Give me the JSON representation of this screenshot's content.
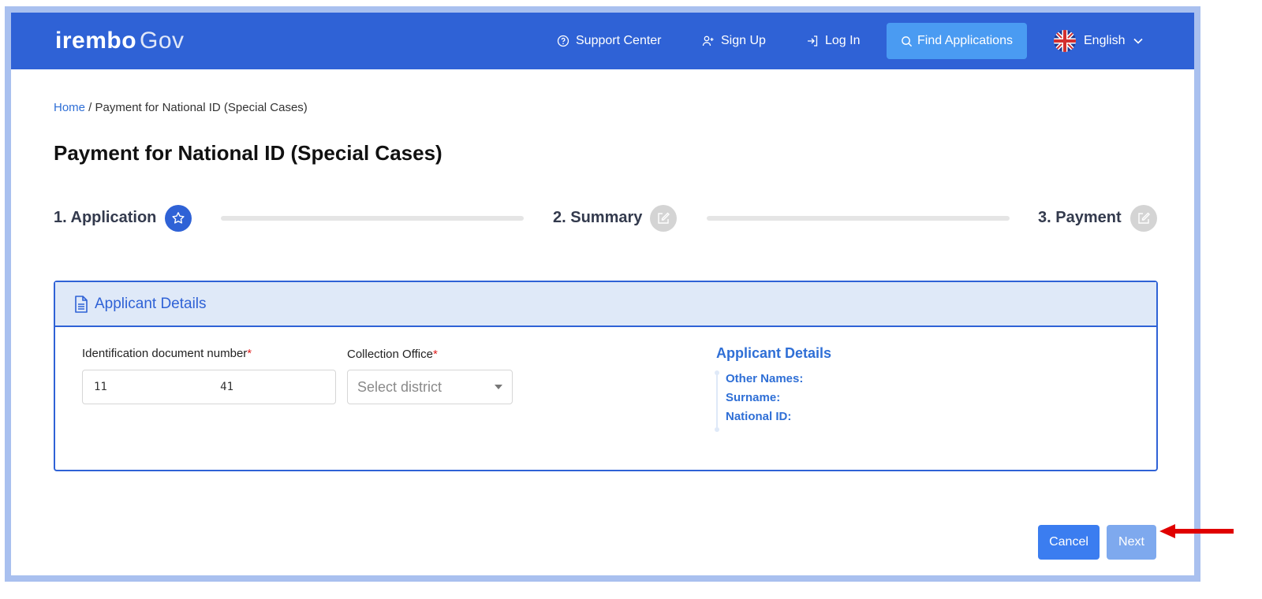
{
  "header": {
    "logo_bold": "irembo",
    "logo_light": "Gov",
    "nav": {
      "support": "Support Center",
      "signup": "Sign Up",
      "login": "Log In",
      "find": "Find Applications"
    },
    "language": "English"
  },
  "breadcrumb": {
    "home": "Home",
    "separator": " / ",
    "current": "Payment for National ID (Special Cases)"
  },
  "page": {
    "title": "Payment for National ID (Special Cases)"
  },
  "stepper": {
    "steps": [
      {
        "label": "1. Application",
        "state": "active",
        "icon": "star-icon"
      },
      {
        "label": "2. Summary",
        "state": "inactive",
        "icon": "edit-icon"
      },
      {
        "label": "3. Payment",
        "state": "inactive",
        "icon": "edit-icon"
      }
    ]
  },
  "card": {
    "title": "Applicant Details",
    "id_label": "Identification document number",
    "id_value": "11                 41",
    "office_label": "Collection Office",
    "required_mark": "*",
    "office_placeholder": "Select district",
    "details_title": "Applicant Details",
    "details": {
      "other_names": "Other Names:",
      "surname": "Surname:",
      "national_id": "National ID:"
    }
  },
  "actions": {
    "cancel": "Cancel",
    "next": "Next"
  },
  "colors": {
    "brand": "#2f62d6",
    "find_button": "#4a9bf2",
    "annotation_arrow": "#e00000"
  }
}
